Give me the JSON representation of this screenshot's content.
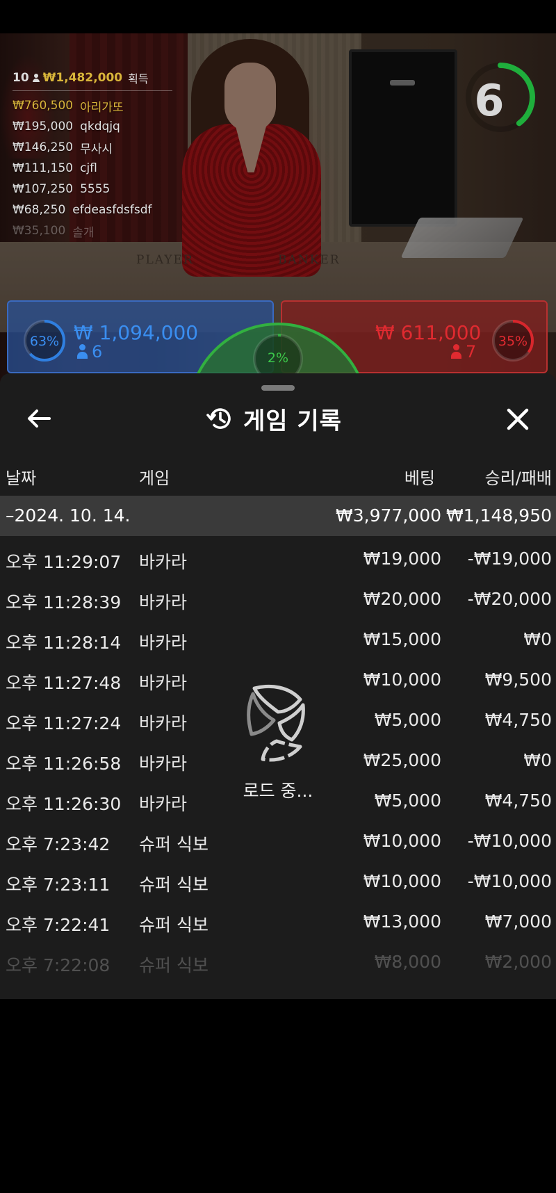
{
  "stream": {
    "table_labels": {
      "player": "PLAYER",
      "banker": "BANKER"
    },
    "leaderboard": {
      "count": "10",
      "total": "₩1,482,000",
      "won_label": "획득",
      "entries": [
        {
          "amount": "₩760,500",
          "name": "아리가또"
        },
        {
          "amount": "₩195,000",
          "name": "qkdqjq"
        },
        {
          "amount": "₩146,250",
          "name": "무사시"
        },
        {
          "amount": "₩111,150",
          "name": "cjfl"
        },
        {
          "amount": "₩107,250",
          "name": "5555"
        },
        {
          "amount": "₩68,250",
          "name": "efdeasfdsfsdf"
        },
        {
          "amount": "₩35,100",
          "name": "솔개"
        }
      ]
    },
    "timer": {
      "value": "6",
      "fraction": 0.4,
      "color": "#1fae3c"
    },
    "bets": {
      "player": {
        "percent": "63%",
        "percent_value": 0.63,
        "amount": "₩ 1,094,000",
        "count": "6",
        "color": "#2f7fe0"
      },
      "banker": {
        "percent": "35%",
        "percent_value": 0.35,
        "amount": "₩ 611,000",
        "count": "7",
        "color": "#d8262c"
      },
      "tie": {
        "percent": "2%",
        "percent_value": 0.02,
        "color": "#32b040"
      }
    }
  },
  "sheet": {
    "title": "게임 기록",
    "icons": {
      "back": "arrow-left-icon",
      "history": "history-icon",
      "close": "close-icon",
      "loader": "spinner-icon"
    },
    "columns": {
      "date": "날짜",
      "game": "게임",
      "bet": "베팅",
      "win_loss": "승리/패배"
    },
    "date_group": {
      "date": "–2024. 10. 14.",
      "bet_total": "₩3,977,000",
      "win_total": "₩1,148,950"
    },
    "rows": [
      {
        "time": "오후 11:29:07",
        "game": "바카라",
        "bet": "₩19,000",
        "result": "-₩19,000"
      },
      {
        "time": "오후 11:28:39",
        "game": "바카라",
        "bet": "₩20,000",
        "result": "-₩20,000"
      },
      {
        "time": "오후 11:28:14",
        "game": "바카라",
        "bet": "₩15,000",
        "result": "₩0"
      },
      {
        "time": "오후 11:27:48",
        "game": "바카라",
        "bet": "₩10,000",
        "result": "₩9,500"
      },
      {
        "time": "오후 11:27:24",
        "game": "바카라",
        "bet": "₩5,000",
        "result": "₩4,750"
      },
      {
        "time": "오후 11:26:58",
        "game": "바카라",
        "bet": "₩25,000",
        "result": "₩0"
      },
      {
        "time": "오후 11:26:30",
        "game": "바카라",
        "bet": "₩5,000",
        "result": "₩4,750"
      },
      {
        "time": "오후 7:23:42",
        "game": "슈퍼 식보",
        "bet": "₩10,000",
        "result": "-₩10,000"
      },
      {
        "time": "오후 7:23:11",
        "game": "슈퍼 식보",
        "bet": "₩10,000",
        "result": "-₩10,000"
      },
      {
        "time": "오후 7:22:41",
        "game": "슈퍼 식보",
        "bet": "₩13,000",
        "result": "₩7,000"
      },
      {
        "time": "오후 7:22:08",
        "game": "슈퍼 식보",
        "bet": "₩8,000",
        "result": "₩2,000"
      }
    ],
    "loading_text": "로드 중..."
  }
}
